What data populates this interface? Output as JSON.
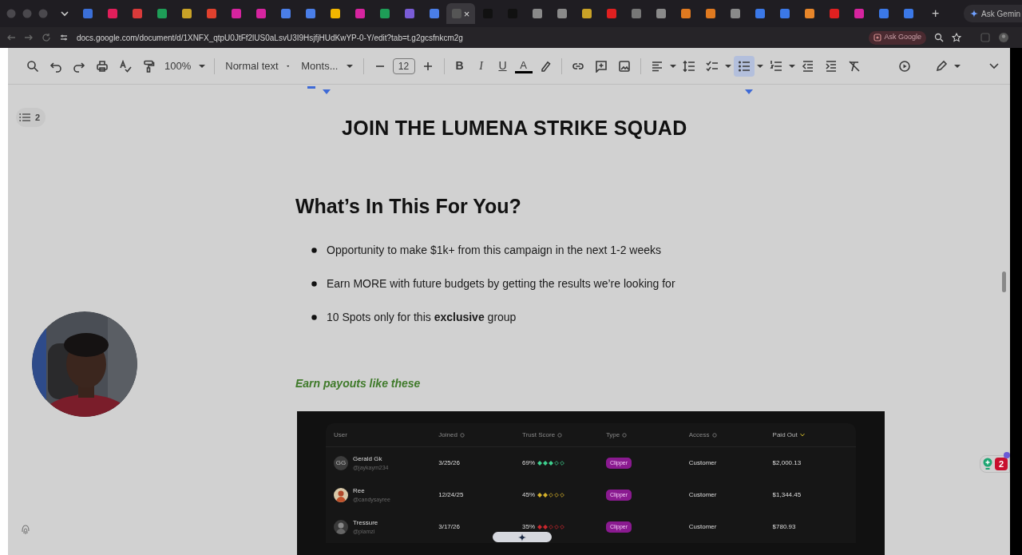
{
  "browser": {
    "tabs": [
      {
        "color": "#3b6fd8",
        "selected": false
      },
      {
        "color": "#e01e5a",
        "selected": false
      },
      {
        "color": "#d93a3a",
        "selected": false
      },
      {
        "color": "#1e9d57",
        "selected": false
      },
      {
        "color": "#c9a227",
        "selected": false
      },
      {
        "color": "#e0412e",
        "selected": false
      },
      {
        "color": "#d6249f",
        "selected": false
      },
      {
        "color": "#d6249f",
        "selected": false
      },
      {
        "color": "#4a7ee8",
        "selected": false
      },
      {
        "color": "#4a7ee8",
        "selected": false
      },
      {
        "color": "#f2b600",
        "selected": false
      },
      {
        "color": "#d6249f",
        "selected": false
      },
      {
        "color": "#1e9d57",
        "selected": false
      },
      {
        "color": "#7a5cd6",
        "selected": false
      },
      {
        "color": "#4a7ee8",
        "selected": false
      },
      {
        "color": "#555555",
        "selected": true
      },
      {
        "color": "#111111",
        "selected": false
      },
      {
        "color": "#111111",
        "selected": false
      },
      {
        "color": "#8a8a8a",
        "selected": false
      },
      {
        "color": "#8a8a8a",
        "selected": false
      },
      {
        "color": "#c9a227",
        "selected": false
      },
      {
        "color": "#e02020",
        "selected": false
      },
      {
        "color": "#777777",
        "selected": false
      },
      {
        "color": "#8a8a8a",
        "selected": false
      },
      {
        "color": "#e07a20",
        "selected": false
      },
      {
        "color": "#e07a20",
        "selected": false
      },
      {
        "color": "#8a8a8a",
        "selected": false
      },
      {
        "color": "#3b78e7",
        "selected": false
      },
      {
        "color": "#3b78e7",
        "selected": false
      },
      {
        "color": "#e8862a",
        "selected": false
      },
      {
        "color": "#e02020",
        "selected": false
      },
      {
        "color": "#d6249f",
        "selected": false
      },
      {
        "color": "#3b78e7",
        "selected": false
      },
      {
        "color": "#3b78e7",
        "selected": false
      }
    ],
    "close_tab": "×",
    "new_tab": "+",
    "gemini": "Ask Gemin",
    "address": "docs.google.com/document/d/1XNFX_qtpU0JtFf2lUS0aLsvU3I9HsjfjHUdKwYP-0-Y/edit?tab=t.g2gcsfnkcm2g",
    "ask_google": "Ask Google"
  },
  "toolbar": {
    "zoom": "100%",
    "style": "Normal text",
    "font": "Monts...",
    "font_size": "12",
    "bold": "B",
    "italic": "I",
    "underline": "U",
    "text_color": "A",
    "bullets_selected": true
  },
  "outline": {
    "count": "2"
  },
  "document": {
    "title": "JOIN THE LUMENA STRIKE SQUAD",
    "heading": "What’s In This For You?",
    "bullets": [
      "Opportunity to make $1k+ from this campaign in the next 1-2 weeks",
      "Earn MORE with future budgets by getting the results we’re looking for",
      "10 Spots only for this **exclusive** group"
    ],
    "subheading": "Earn payouts like these",
    "table": {
      "columns": [
        {
          "label": "User"
        },
        {
          "label": "Joined",
          "sorted": false
        },
        {
          "label": "Trust Score",
          "sorted": false
        },
        {
          "label": "Type",
          "sorted": false
        },
        {
          "label": "Access",
          "sorted": false
        },
        {
          "label": "Paid Out",
          "sorted": true
        }
      ],
      "rows": [
        {
          "kind": "initials",
          "initials": "GG",
          "name": "Gerald Gk",
          "handle": "@jaykaym234",
          "joined": "3/25/26",
          "trust": "69%",
          "stars": 3,
          "color": "#3ecf8e",
          "type": "Clipper",
          "access": "Customer",
          "paid": "$2,000.13"
        },
        {
          "name": "Ree",
          "handle": "@candysayree",
          "joined": "12/24/25",
          "trust": "45%",
          "stars": 2,
          "color": "#d4b02a",
          "type": "Clipper",
          "access": "Customer",
          "paid": "$1,344.45"
        },
        {
          "name": "Tressure",
          "handle": "@plamzi",
          "joined": "3/17/26",
          "trust": "35%",
          "stars": 2,
          "color": "#c8262d",
          "type": "Clipper",
          "access": "Customer",
          "paid": "$780.93"
        }
      ]
    }
  },
  "comments": {
    "count": "2"
  }
}
